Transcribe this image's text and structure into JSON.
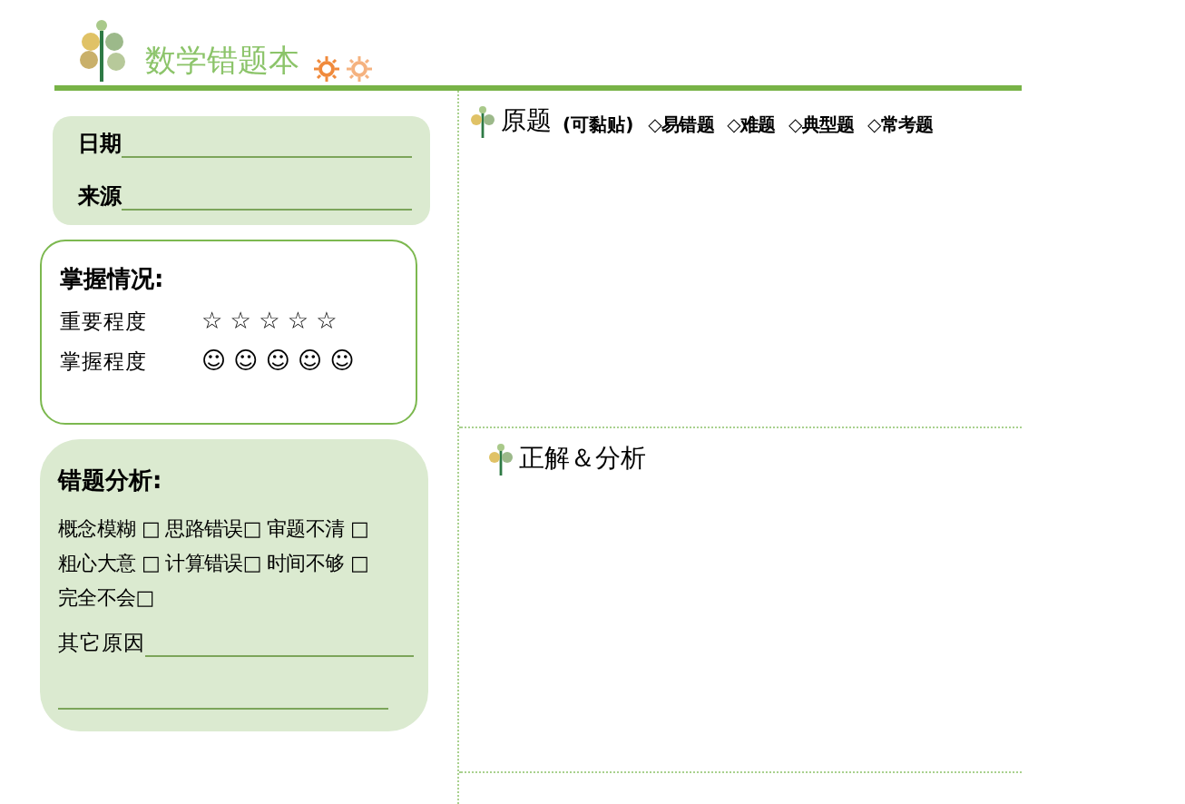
{
  "header": {
    "title": "数学错题本"
  },
  "info_card": {
    "fields": [
      {
        "label": "日期"
      },
      {
        "label": "来源"
      }
    ]
  },
  "mastery_card": {
    "title": "掌握情况:",
    "rows": [
      {
        "label": "重要程度",
        "symbols": "☆ ☆ ☆ ☆ ☆"
      },
      {
        "label": "掌握程度",
        "symbols": "☺ ☺ ☺ ☺ ☺"
      }
    ]
  },
  "analysis_card": {
    "title": "错题分析:",
    "options": [
      "概念模糊 □",
      "思路错误□",
      "审题不清 □",
      "粗心大意 □",
      "计算错误□",
      "时间不够 □",
      "完全不会□"
    ],
    "other_label": "其它原因"
  },
  "question_section": {
    "title": "原题",
    "note": "(可黏贴)",
    "tags": [
      "◇易错题",
      "◇难题",
      "◇典型题",
      "◇常考题"
    ]
  },
  "answer_section": {
    "title": "正解＆分析"
  }
}
